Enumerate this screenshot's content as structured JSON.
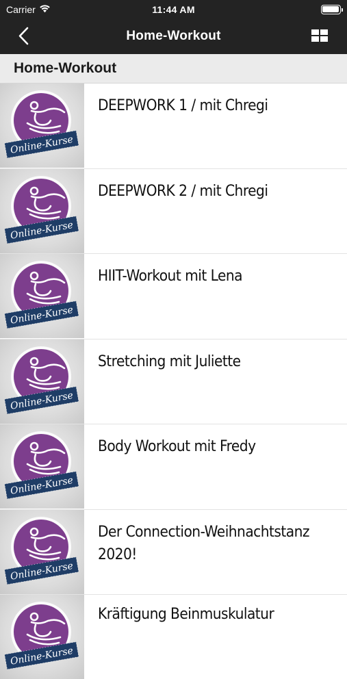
{
  "status_bar": {
    "carrier": "Carrier",
    "time": "11:44 AM"
  },
  "nav": {
    "title": "Home-Workout"
  },
  "section": {
    "title": "Home-Workout"
  },
  "thumbnail": {
    "badge_text": "Online-Kurse",
    "colors": {
      "circle": "#7d3e8d",
      "badge": "#1f3d66"
    }
  },
  "items": [
    {
      "title": "DEEPWORK 1 / mit Chregi"
    },
    {
      "title": "DEEPWORK 2 / mit Chregi"
    },
    {
      "title": "HIIT-Workout mit Lena"
    },
    {
      "title": "Stretching mit Juliette"
    },
    {
      "title": "Body Workout mit Fredy"
    },
    {
      "title": "Der Connection-Weihnachtstanz 2020!"
    },
    {
      "title": "Kräftigung Beinmuskulatur"
    }
  ],
  "theme": {
    "bar_background": "#232323",
    "section_background": "#ebebeb"
  }
}
